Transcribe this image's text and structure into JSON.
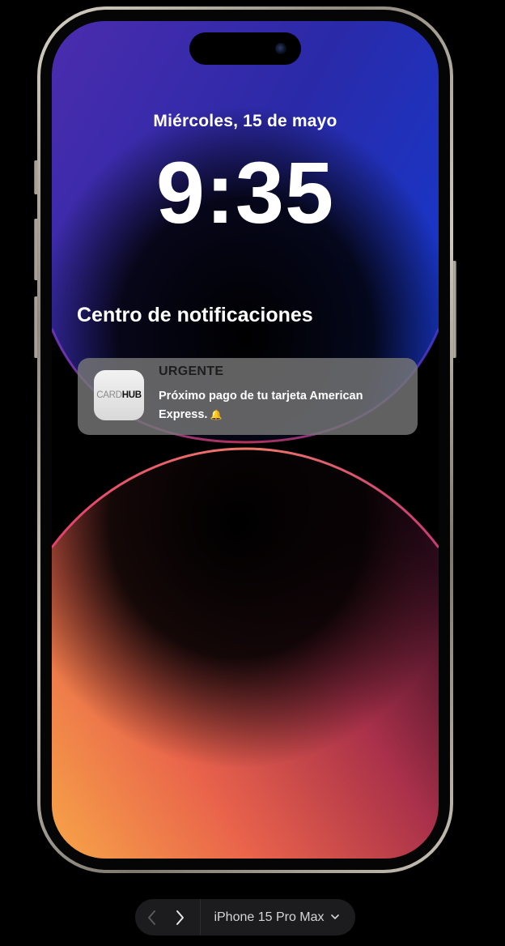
{
  "lockscreen": {
    "date": "Miércoles, 15 de mayo",
    "time": "9:35"
  },
  "notification_center": {
    "title": "Centro de notificaciones"
  },
  "notification": {
    "app_logo": {
      "part1": "CARD",
      "part2": "HUB"
    },
    "label": "URGENTE",
    "body": "Próximo pago de tu tarjeta American Express.",
    "emoji": "🔔"
  },
  "device_picker": {
    "selected": "iPhone 15 Pro Max",
    "icons": {
      "prev": "chevron-left-icon",
      "next": "chevron-right-icon",
      "dropdown": "chevron-down-icon"
    }
  },
  "colors": {
    "background": "#000000",
    "notification_bg": "#767676",
    "picker_bg": "#1c1c1e",
    "wallpaper_top": "#4a2fb8",
    "wallpaper_bottom": "#f5a04a"
  }
}
